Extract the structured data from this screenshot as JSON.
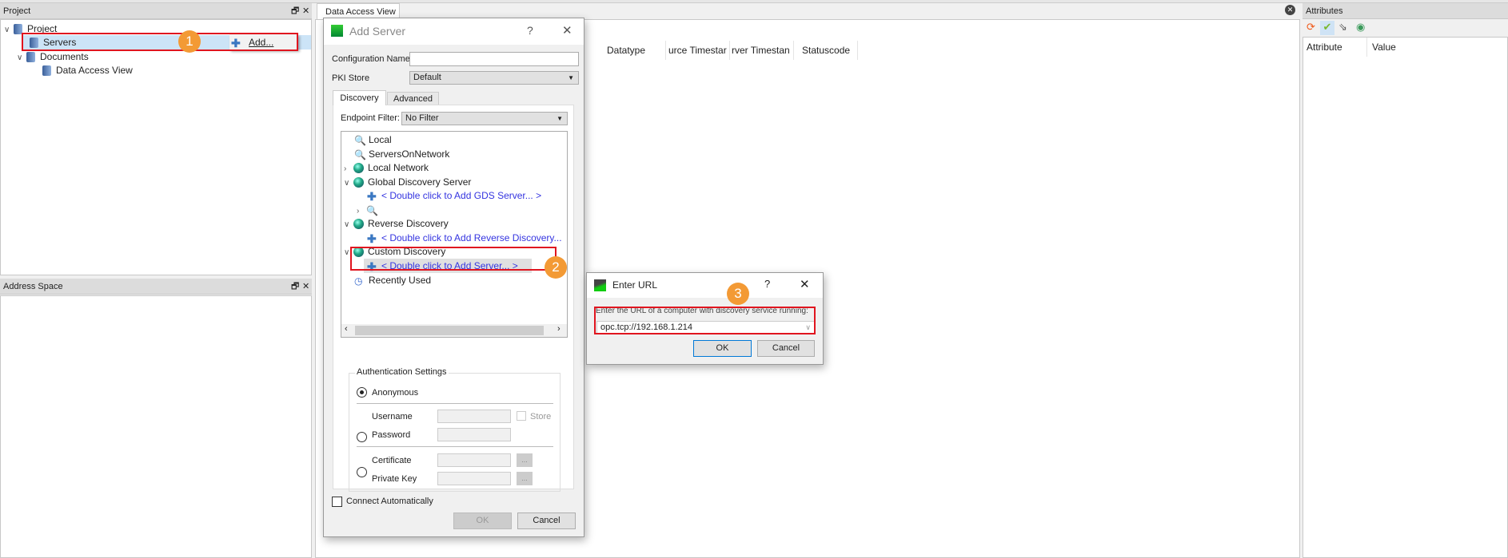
{
  "project_panel": {
    "title": "Project",
    "tree": [
      "Project",
      "Servers",
      "Documents",
      "Data Access View"
    ],
    "context_menu": {
      "add_label": "Add..."
    }
  },
  "address_panel": {
    "title": "Address Space"
  },
  "center": {
    "tab": "Data Access View",
    "columns": [
      "Datatype",
      "urce Timestar",
      "rver Timestan",
      "Statuscode"
    ]
  },
  "attributes_panel": {
    "title": "Attributes",
    "columns": [
      "Attribute",
      "Value"
    ],
    "toolbar_icons": [
      "refresh-icon",
      "check-icon",
      "cursor-icon",
      "record-icon"
    ]
  },
  "add_server": {
    "title": "Add Server",
    "help": "?",
    "close": "✕",
    "config_name_label": "Configuration Name",
    "config_name_value": "",
    "pki_label": "PKI Store",
    "pki_value": "Default",
    "tabs": [
      "Discovery",
      "Advanced"
    ],
    "endpoint_filter_label": "Endpoint Filter:",
    "endpoint_filter_value": "No Filter",
    "tree": {
      "local": "Local",
      "servers_on_network": "ServersOnNetwork",
      "local_network": "Local Network",
      "gds": "Global Discovery Server",
      "gds_add": "< Double click to Add GDS Server... >",
      "reverse": "Reverse Discovery",
      "reverse_add": "< Double click to Add Reverse Discovery...",
      "custom": "Custom Discovery",
      "custom_add": "< Double click to Add Server... >",
      "recent": "Recently Used"
    },
    "auth": {
      "title": "Authentication Settings",
      "anonymous": "Anonymous",
      "username": "Username",
      "password": "Password",
      "store": "Store",
      "certificate": "Certificate",
      "private_key": "Private Key",
      "browse": "..."
    },
    "connect_auto": "Connect Automatically",
    "ok": "OK",
    "cancel": "Cancel"
  },
  "enter_url": {
    "title": "Enter URL",
    "help": "?",
    "close": "✕",
    "prompt": "Enter the URL of a computer with discovery service running:",
    "url_value": "opc.tcp://192.168.1.214",
    "ok": "OK",
    "cancel": "Cancel"
  },
  "badges": [
    "1",
    "2",
    "3"
  ],
  "colors": {
    "highlight": "#e0151f",
    "badge": "#f39a35",
    "link": "#3434e0",
    "selection": "#cce4f7"
  }
}
